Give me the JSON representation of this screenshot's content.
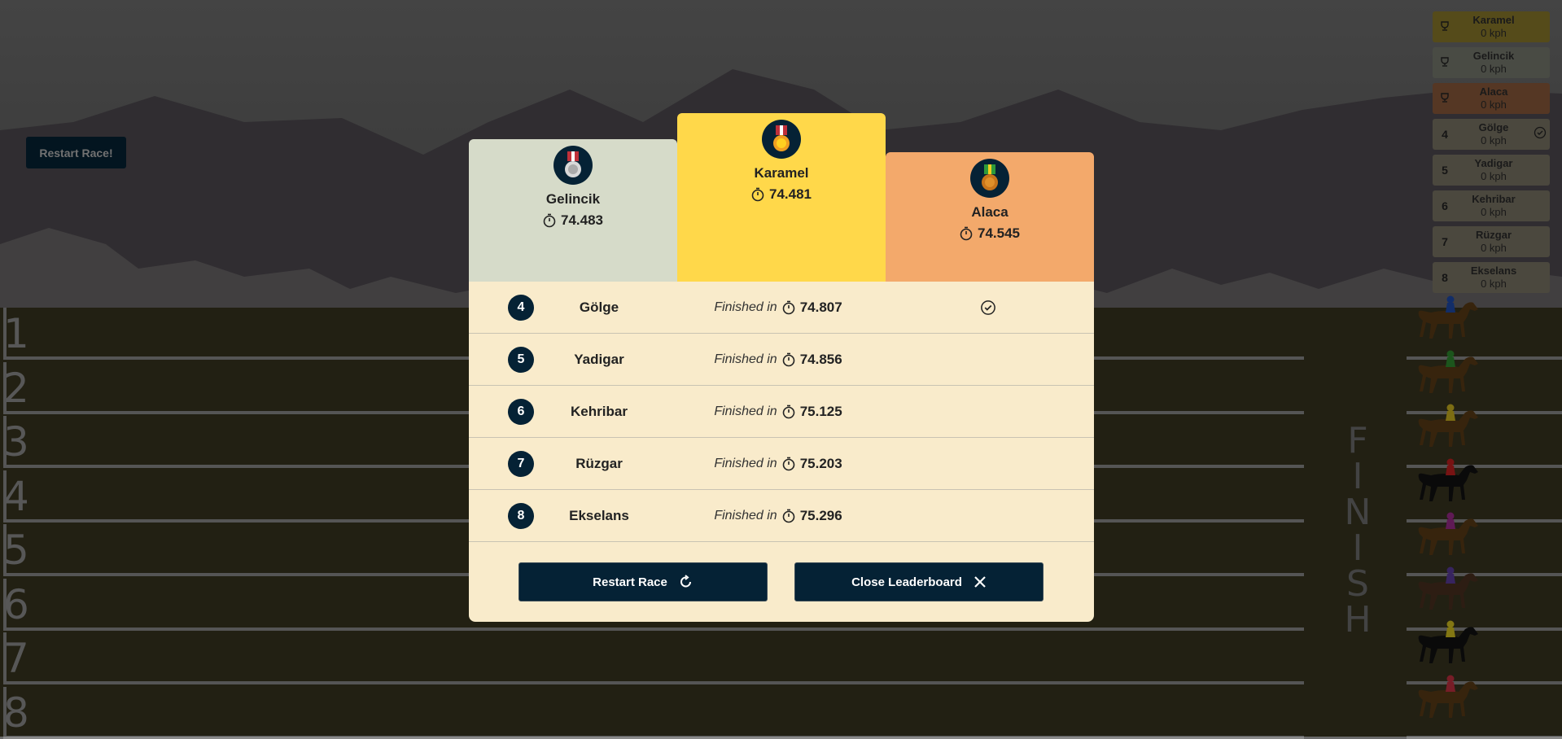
{
  "restart_top_label": "Restart Race!",
  "track": {
    "lanes": [
      "1",
      "2",
      "3",
      "4",
      "5",
      "6",
      "7",
      "8"
    ],
    "finish_label": "F\nI\nN\nI\nS\nH"
  },
  "sidebar": [
    {
      "rank": "",
      "name": "Karamel",
      "speed": "0 kph",
      "color": "#8a7a2a",
      "icon": "trophy-icon"
    },
    {
      "rank": "",
      "name": "Gelincik",
      "speed": "0 kph",
      "color": "#777a6f",
      "icon": "trophy-icon"
    },
    {
      "rank": "",
      "name": "Alaca",
      "speed": "0 kph",
      "color": "#8a5a3a",
      "icon": "trophy-icon"
    },
    {
      "rank": "4",
      "name": "Gölge",
      "speed": "0 kph",
      "color": "#7a7464",
      "check": true
    },
    {
      "rank": "5",
      "name": "Yadigar",
      "speed": "0 kph",
      "color": "#7a7464"
    },
    {
      "rank": "6",
      "name": "Kehribar",
      "speed": "0 kph",
      "color": "#7a7464"
    },
    {
      "rank": "7",
      "name": "Rüzgar",
      "speed": "0 kph",
      "color": "#7a7464"
    },
    {
      "rank": "8",
      "name": "Ekselans",
      "speed": "0 kph",
      "color": "#7a7464"
    }
  ],
  "podium": {
    "second": {
      "name": "Gelincik",
      "time": "74.483",
      "color": "#d6dbc9",
      "medal": "silver-medal-icon"
    },
    "first": {
      "name": "Karamel",
      "time": "74.481",
      "color": "#ffd84a",
      "medal": "gold-medal-icon"
    },
    "third": {
      "name": "Alaca",
      "time": "74.545",
      "color": "#f3a96b",
      "medal": "bronze-medal-icon"
    }
  },
  "results": [
    {
      "pos": "4",
      "name": "Gölge",
      "label": "Finished in",
      "time": "74.807",
      "check": true
    },
    {
      "pos": "5",
      "name": "Yadigar",
      "label": "Finished in",
      "time": "74.856"
    },
    {
      "pos": "6",
      "name": "Kehribar",
      "label": "Finished in",
      "time": "75.125"
    },
    {
      "pos": "7",
      "name": "Rüzgar",
      "label": "Finished in",
      "time": "75.203"
    },
    {
      "pos": "8",
      "name": "Ekselans",
      "label": "Finished in",
      "time": "75.296"
    }
  ],
  "buttons": {
    "restart": "Restart Race",
    "close": "Close Leaderboard"
  },
  "horses": [
    {
      "coat": "#5a3a16",
      "jockey": "#1e4aa8"
    },
    {
      "coat": "#5a3a16",
      "jockey": "#2e8a2e"
    },
    {
      "coat": "#5a3a16",
      "jockey": "#c8b020"
    },
    {
      "coat": "#111111",
      "jockey": "#c02020"
    },
    {
      "coat": "#5a3a16",
      "jockey": "#9a2a8a"
    },
    {
      "coat": "#4a3020",
      "jockey": "#5a3a9a"
    },
    {
      "coat": "#111111",
      "jockey": "#d4c020"
    },
    {
      "coat": "#5a3a16",
      "jockey": "#c03040"
    }
  ]
}
